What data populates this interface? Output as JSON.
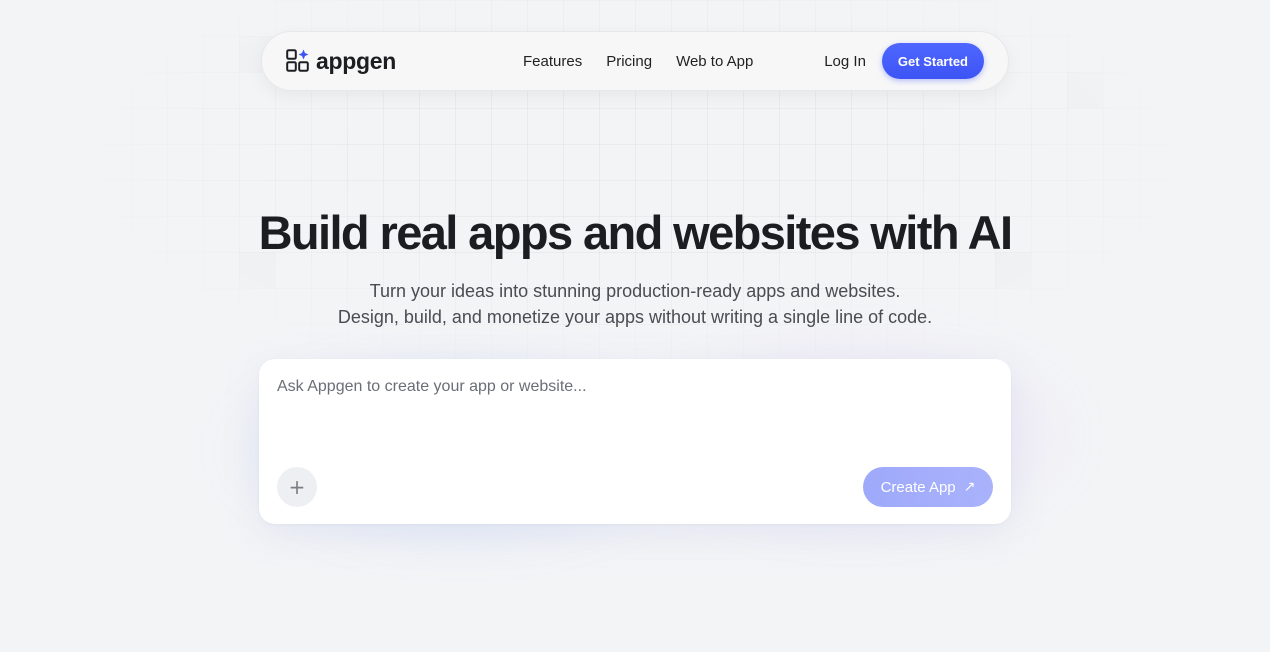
{
  "brand": {
    "name": "appgen",
    "logo_icon": "grid-sparkle-icon",
    "accent_color": "#3d54f5"
  },
  "nav": {
    "links": [
      {
        "label": "Features"
      },
      {
        "label": "Pricing"
      },
      {
        "label": "Web to App"
      }
    ],
    "login_label": "Log In",
    "cta_label": "Get Started"
  },
  "hero": {
    "title": "Build real apps and websites with AI",
    "subtitle_line1": "Turn your ideas into stunning production-ready apps and websites.",
    "subtitle_line2": "Design, build, and monetize your apps without writing a single line of code."
  },
  "prompt": {
    "placeholder": "Ask Appgen to create your app or website...",
    "value": "",
    "attach_icon": "plus-icon",
    "attach_glyph": "+",
    "submit_label": "Create App",
    "submit_icon": "arrow-up-right-icon",
    "submit_glyph": "↗"
  }
}
